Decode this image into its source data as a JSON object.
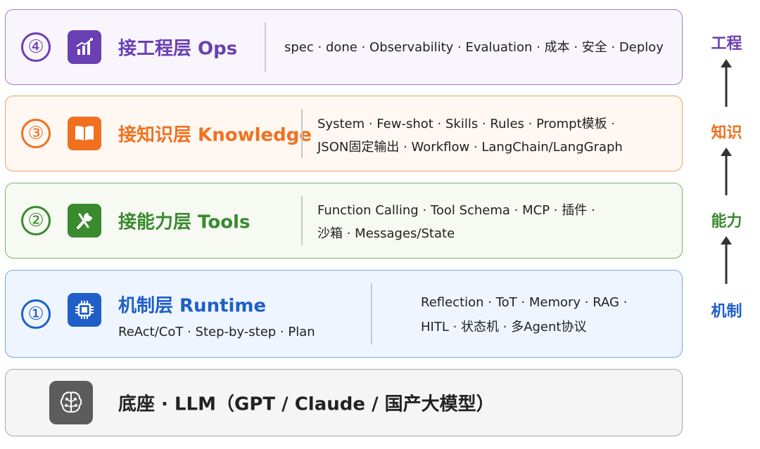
{
  "colors": {
    "ops": "#6a3fb3",
    "ops_bg": "#f8f5fd",
    "ops_border": "#9d7cd0",
    "knowledge": "#f07020",
    "knowledge_bg": "#fff8f2",
    "knowledge_border": "#f2a067",
    "tools": "#3a8a2e",
    "tools_bg": "#f6faf3",
    "tools_border": "#79b56a",
    "runtime": "#1f5fc7",
    "runtime_bg": "#eef5ff",
    "runtime_border": "#79a6e0",
    "base": "#222222",
    "base_bg": "#f5f5f5",
    "base_border": "#a8a8a8"
  },
  "layers": {
    "ops": {
      "number": "④",
      "icon": "bar-chart-icon",
      "title": "接工程层 Ops",
      "items": "spec · done · Observability · Evaluation · 成本 · 安全 · Deploy"
    },
    "knowledge": {
      "number": "③",
      "icon": "book-icon",
      "title": "接知识层 Knowledge",
      "line1": "System · Few-shot · Skills · Rules · Prompt模板 ·",
      "line2": "JSON固定输出 · Workflow · LangChain/LangGraph"
    },
    "tools": {
      "number": "②",
      "icon": "wrench-icon",
      "title": "接能力层 Tools",
      "line1": "Function Calling · Tool Schema · MCP · 插件 ·",
      "line2": "沙箱 · Messages/State"
    },
    "runtime": {
      "number": "①",
      "icon": "chip-icon",
      "title": "机制层 Runtime",
      "subtitle": "ReAct/CoT · Step-by-step · Plan",
      "line1": "Reflection · ToT · Memory · RAG ·",
      "line2": "HITL · 状态机 · 多Agent协议"
    },
    "base": {
      "icon": "brain-icon",
      "title": "底座 · LLM（GPT / Claude / 国产大模型）"
    }
  },
  "side_labels": {
    "top": "工程",
    "second": "知识",
    "third": "能力",
    "bottom": "机制"
  }
}
